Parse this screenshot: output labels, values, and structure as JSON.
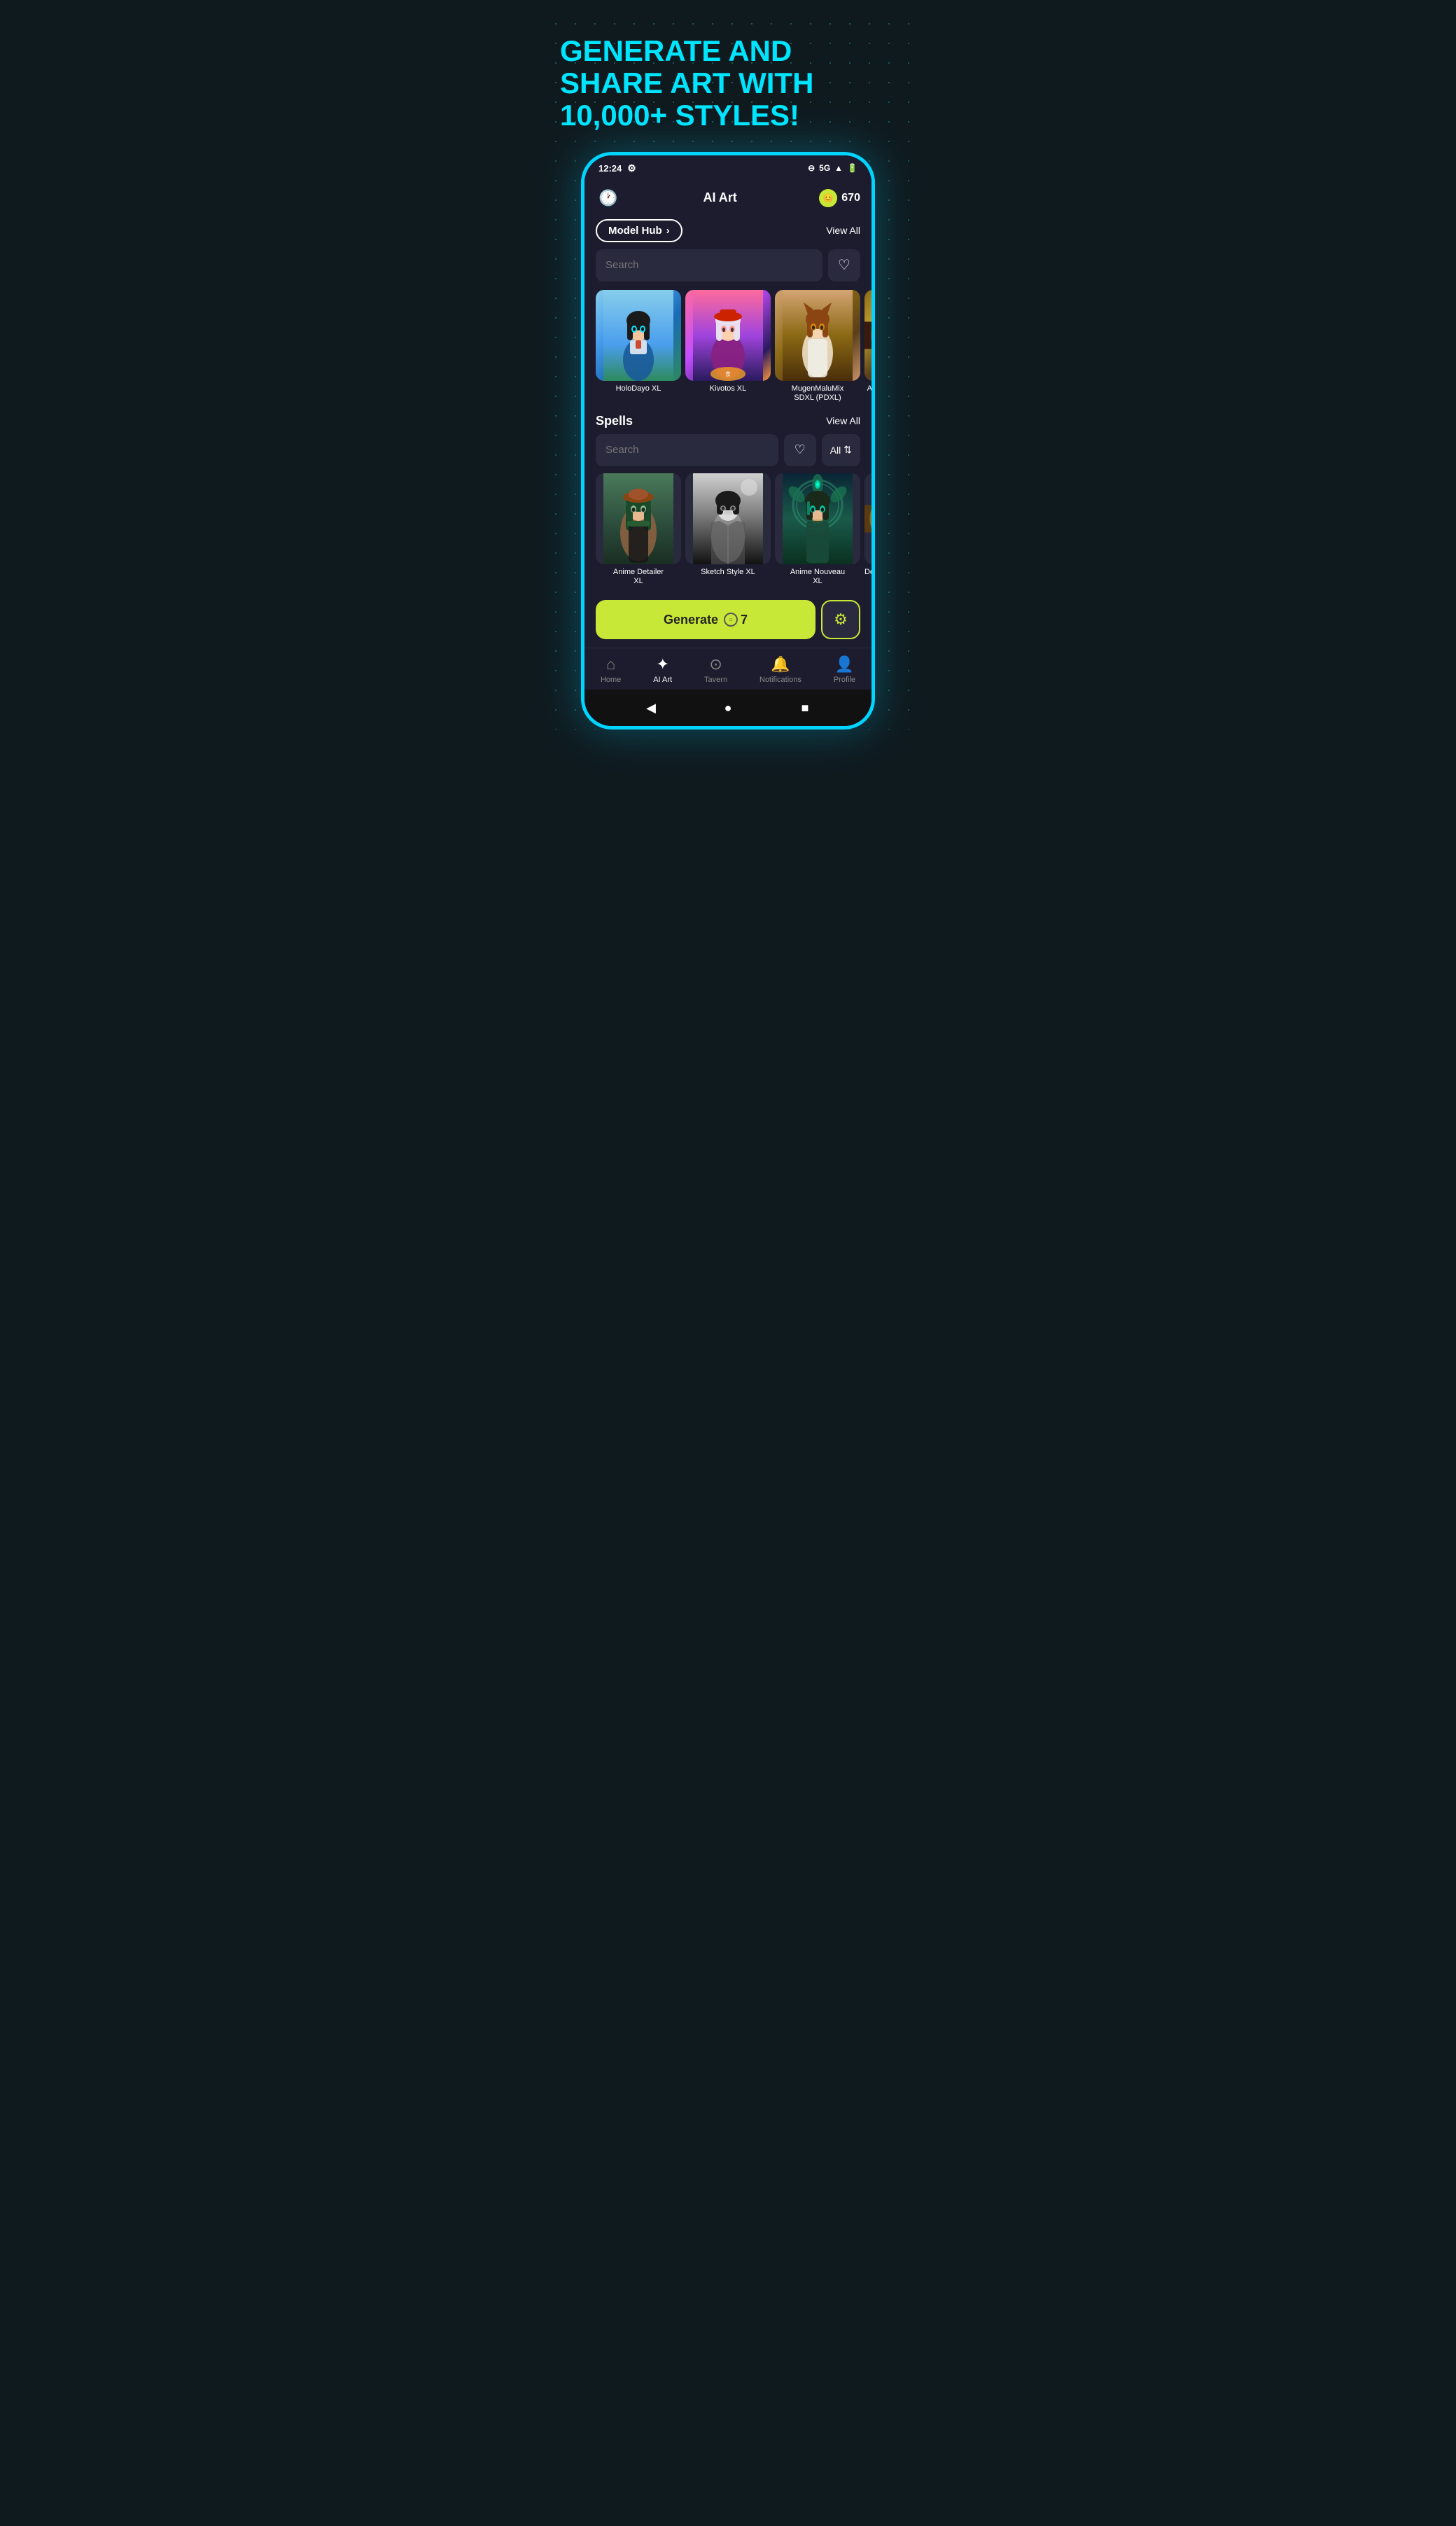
{
  "page": {
    "headline": "GENERATE AND\nSHARE ART WITH\n10,000+ STYLES!",
    "status_bar": {
      "time": "12:24",
      "signal": "5G",
      "battery": "100"
    },
    "header": {
      "title": "AI Art",
      "coins": "670"
    },
    "model_hub": {
      "label": "Model Hub",
      "view_all": "View All"
    },
    "model_search": {
      "placeholder": "Search"
    },
    "models": [
      {
        "name": "HoloDayo XL",
        "img_class": "img-holodayo"
      },
      {
        "name": "Kivotos XL",
        "img_class": "img-kivotos"
      },
      {
        "name": "MugenMaluMix SDXL (PDXL)",
        "img_class": "img-mugen"
      },
      {
        "name": "An...",
        "img_class": "img-deta"
      }
    ],
    "spells": {
      "title": "Spells",
      "view_all": "View All",
      "search_placeholder": "Search",
      "filter_label": "All"
    },
    "spell_items": [
      {
        "name": "Anime Detailer XL",
        "img_class": "img-anime-detailer"
      },
      {
        "name": "Sketch Style XL",
        "img_class": "img-sketch"
      },
      {
        "name": "Anime Nouveau XL",
        "img_class": "img-anime-nouveau"
      },
      {
        "name": "Deta...",
        "img_class": "img-deta"
      }
    ],
    "generate": {
      "label": "Generate",
      "cost": "7"
    },
    "bottom_nav": [
      {
        "id": "home",
        "label": "Home",
        "icon": "⌂",
        "active": false
      },
      {
        "id": "ai_art",
        "label": "AI Art",
        "icon": "✦",
        "active": true
      },
      {
        "id": "tavern",
        "label": "Tavern",
        "icon": "⊙",
        "active": false
      },
      {
        "id": "notifications",
        "label": "Notifications",
        "icon": "🔔",
        "active": false
      },
      {
        "id": "profile",
        "label": "Profile",
        "icon": "👤",
        "active": false
      }
    ],
    "phone_nav": {
      "back": "◀",
      "home": "●",
      "recent": "■"
    }
  }
}
